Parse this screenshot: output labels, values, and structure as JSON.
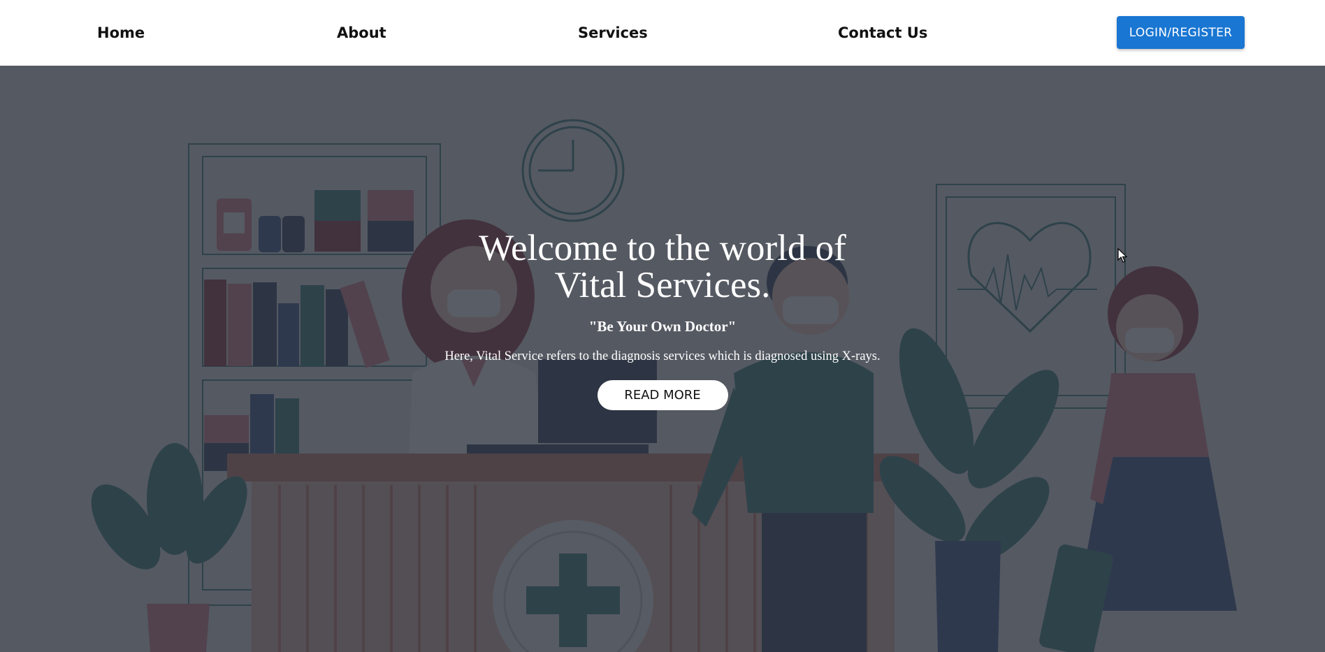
{
  "nav": {
    "links": [
      "Home",
      "About",
      "Services",
      "Contact Us"
    ],
    "login_label": "LOGIN/REGISTER"
  },
  "hero": {
    "title_line1": "Welcome to the world of",
    "title_line2": "Vital Services.",
    "tagline": "\"Be Your Own Doctor\"",
    "description": "Here, Vital Service refers to the diagnosis services which is diagnosed using X-rays.",
    "read_more_label": "READ MORE"
  },
  "colors": {
    "accent": "#1976d2",
    "overlay": "#30343e",
    "teal": "#2a7a7a",
    "pink": "#d47a8e"
  },
  "illustration": {
    "scene": "clinic-reception-illustration"
  }
}
